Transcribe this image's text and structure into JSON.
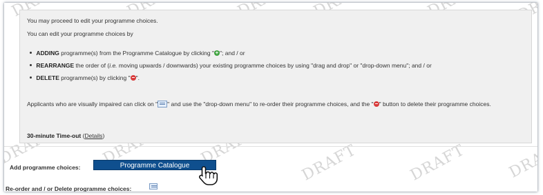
{
  "watermark_text": "DRAFT",
  "instructions": {
    "line1": "You may proceed to edit your programme choices.",
    "line2": "You can edit your programme choices by",
    "adding_strong": "ADDING",
    "adding_text": " programme(s) from the Programme Catalogue by clicking \"",
    "adding_end": "\"; and / or",
    "rearrange_strong": "REARRANGE",
    "rearrange_pre": " the order of (",
    "rearrange_ie": "i.e.",
    "rearrange_text": " moving upwards / downwards) your existing programme choices by using \"drag and drop\" or \"drop-down menu\"; and / or",
    "delete_strong": "DELETE",
    "delete_text": " programme(s) by clicking \"",
    "delete_end": "\".",
    "visually_impaired_start": "Applicants who are visually impaired can click on \"",
    "visually_impaired_mid": "\" and use the \"drop-down menu\" to re-order their programme choices, and the \"",
    "visually_impaired_end": "\" button to delete their programme choices.",
    "timeout_strong": "30-minute Time-out",
    "timeout_open": " (",
    "details_link": "Details",
    "timeout_close": ")"
  },
  "form": {
    "add_label": "Add programme choices:",
    "catalogue_button": "Programme Catalogue",
    "reorder_label": "Re-order and / or Delete programme choices:"
  },
  "colors": {
    "button_bg": "#0f4f8e",
    "info_bg": "#f0f0f0",
    "add_icon": "#3fa33f",
    "delete_icon": "#d83b3b"
  },
  "icons": [
    "plus-icon",
    "minus-icon",
    "reorder-icon",
    "hand-cursor-icon"
  ]
}
